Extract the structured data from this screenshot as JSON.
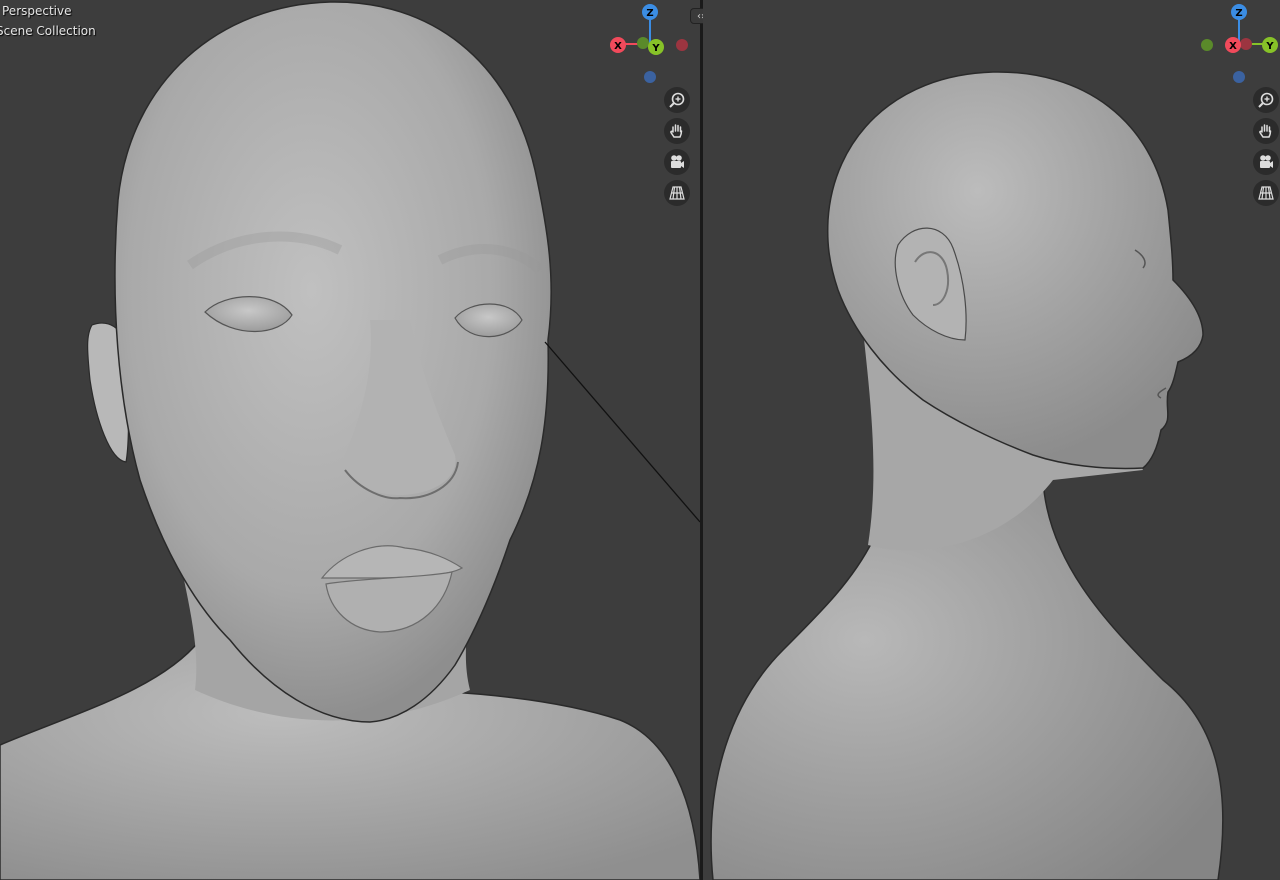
{
  "left_viewport": {
    "title": "Perspective",
    "collection": "Scene Collection",
    "gizmo": {
      "x_label": "X",
      "y_label": "Y",
      "z_label": "Z"
    },
    "nav_buttons": [
      "zoom-icon",
      "hand-pan-icon",
      "camera-view-icon",
      "grid-ortho-icon"
    ]
  },
  "right_viewport": {
    "gizmo": {
      "x_label": "X",
      "y_label": "Y",
      "z_label": "Z"
    },
    "nav_buttons": [
      "zoom-icon",
      "hand-pan-icon",
      "camera-view-icon",
      "grid-ortho-icon"
    ]
  },
  "colors": {
    "background": "#3d3d3d",
    "axis_x": "#f14a5b",
    "axis_y": "#87c228",
    "axis_z": "#3b8de4",
    "model_gray": "#a8a8a8"
  }
}
